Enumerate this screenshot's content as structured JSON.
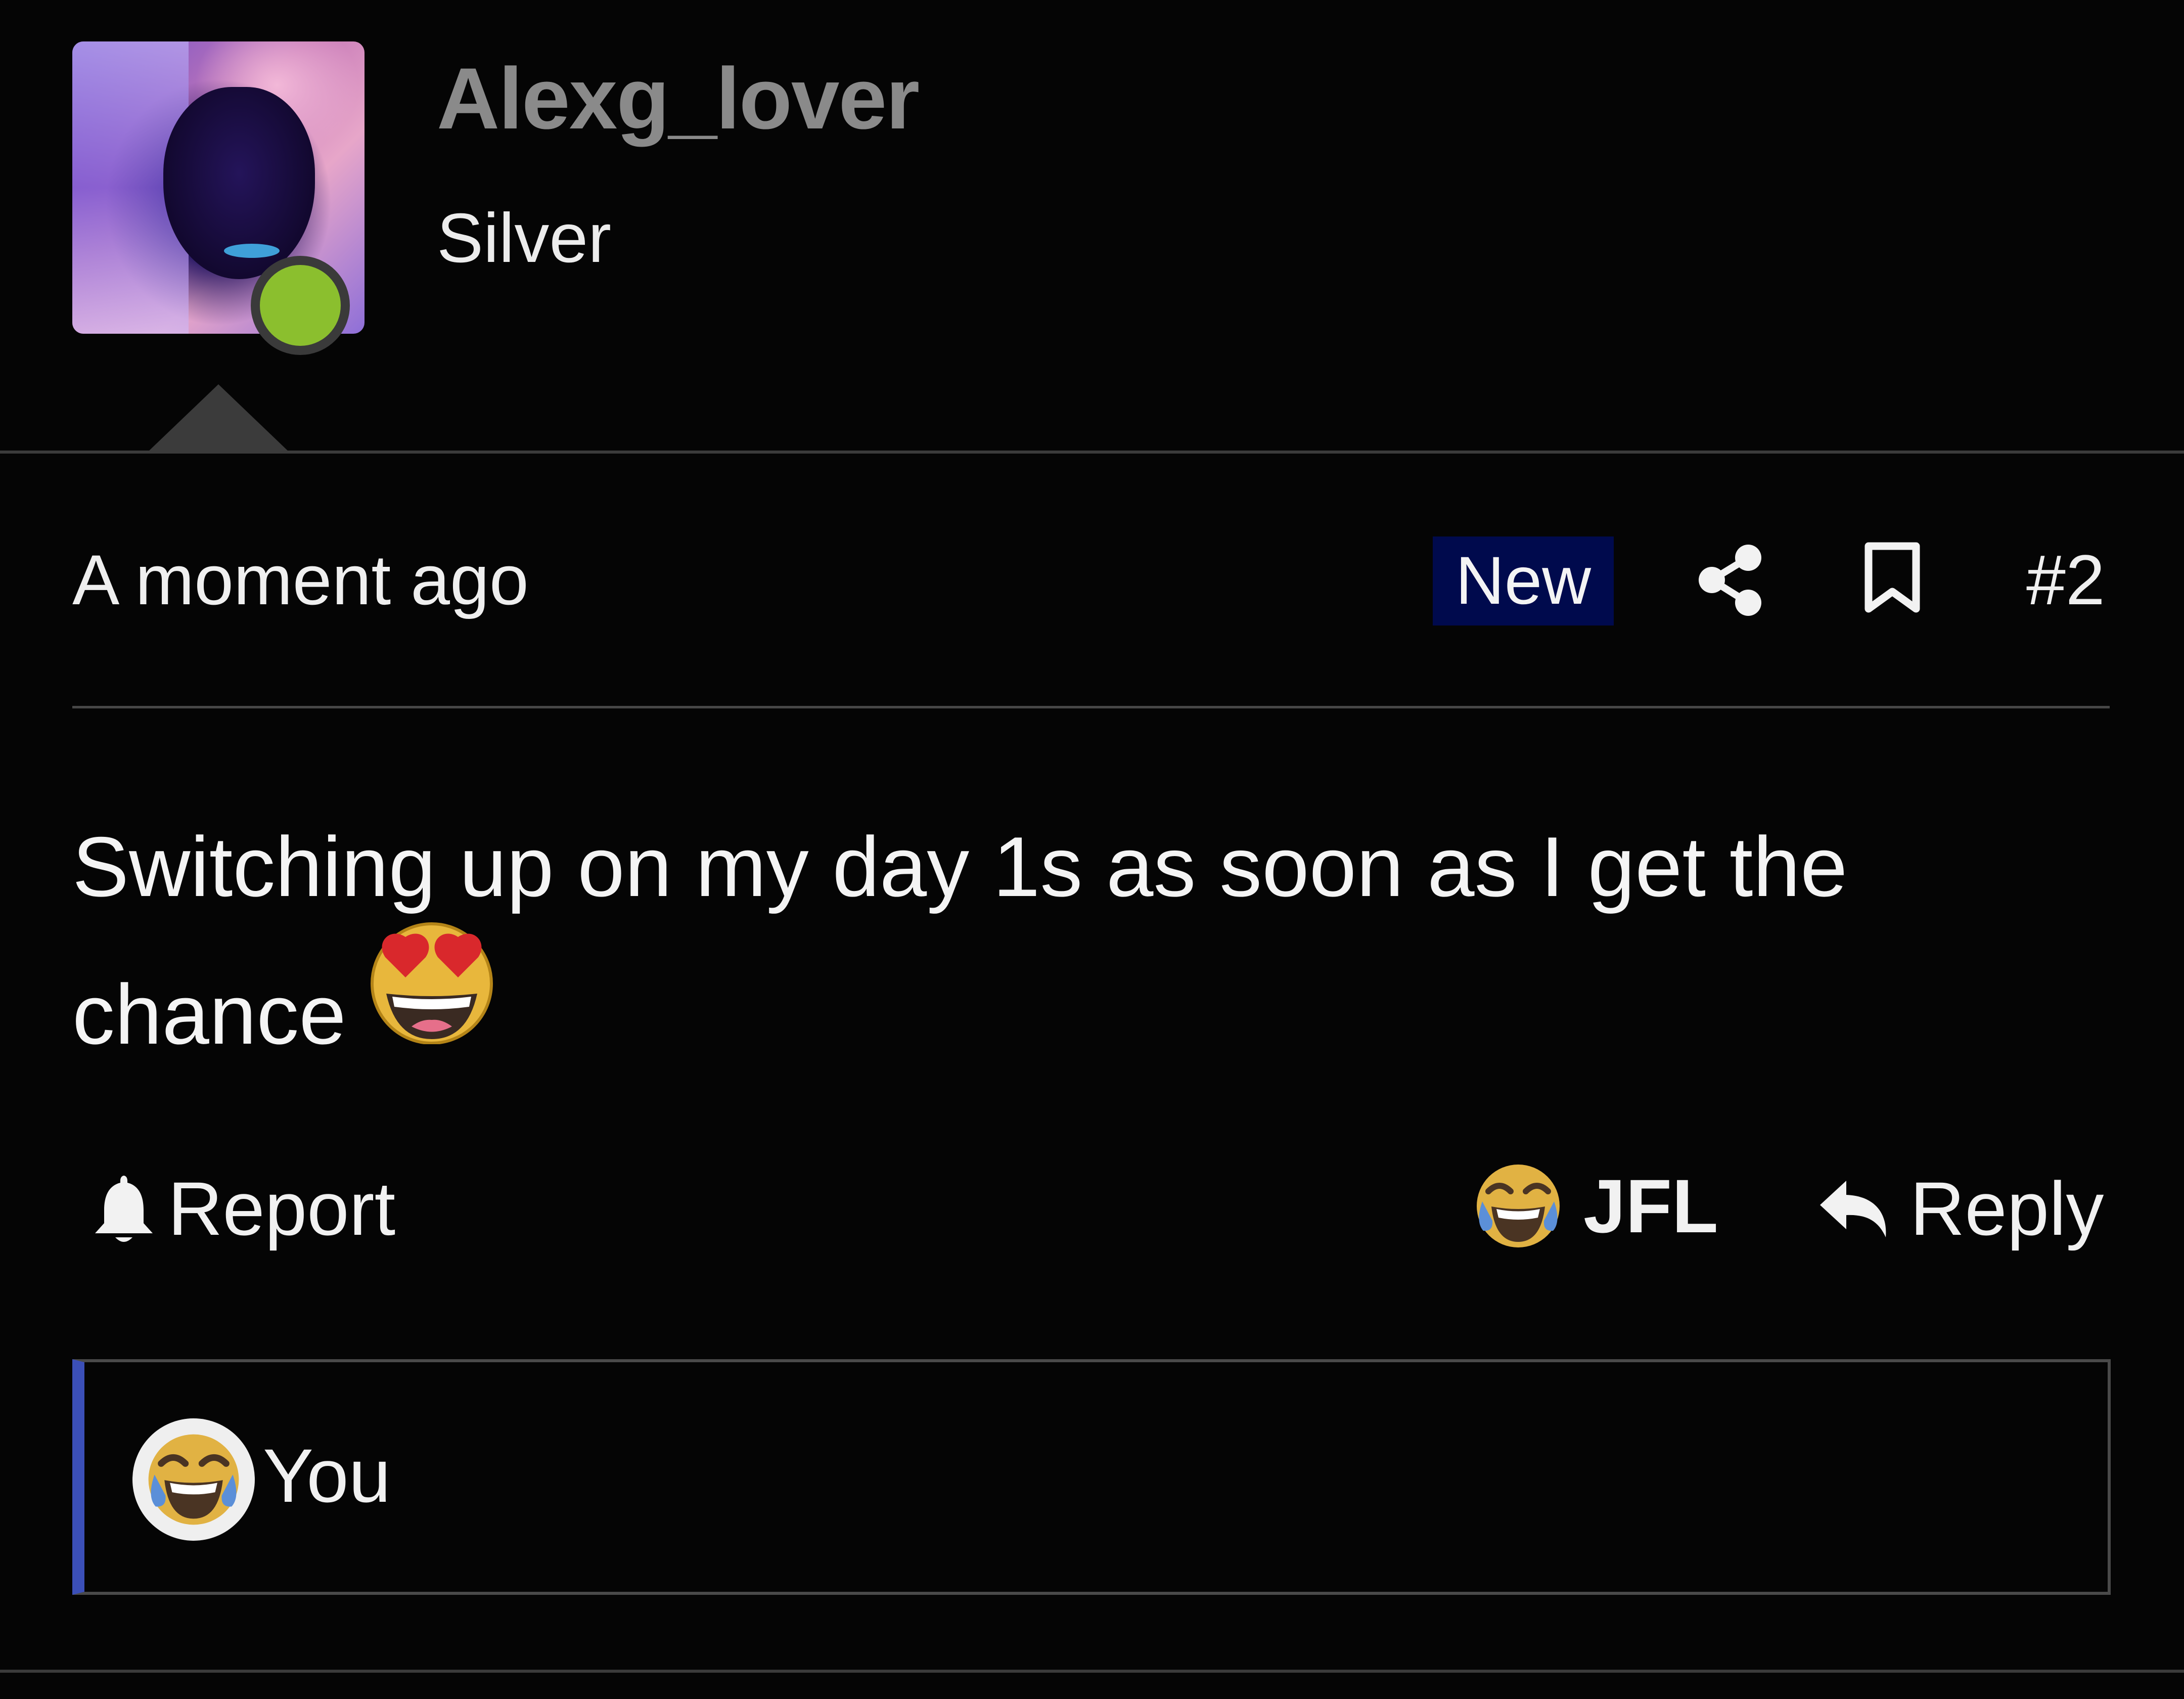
{
  "author": {
    "username": "Alexg_lover",
    "rank": "Silver",
    "avatar_icon": "user-avatar",
    "online_status_color": "#8bbf2e"
  },
  "post": {
    "timestamp": "A moment ago",
    "badge": "New",
    "badge_color": "#000a4d",
    "number": "#2",
    "body_line1": "Switching up on my day 1s as soon as I get the",
    "body_line2": "chance",
    "body_emoji": "smiling-face-with-heart-eyes"
  },
  "icons": {
    "share": "share-icon",
    "bookmark": "bookmark-icon",
    "report": "bell-icon",
    "reaction": "face-with-tears-of-joy-icon",
    "reply": "reply-arrow-icon"
  },
  "actions": {
    "report_label": "Report",
    "reaction_label": "JFL",
    "reply_label": "Reply"
  },
  "reactions_panel": {
    "accent_color": "#3b4fb8",
    "reactor_name": "You",
    "reactor_reaction": "face-with-tears-of-joy"
  }
}
